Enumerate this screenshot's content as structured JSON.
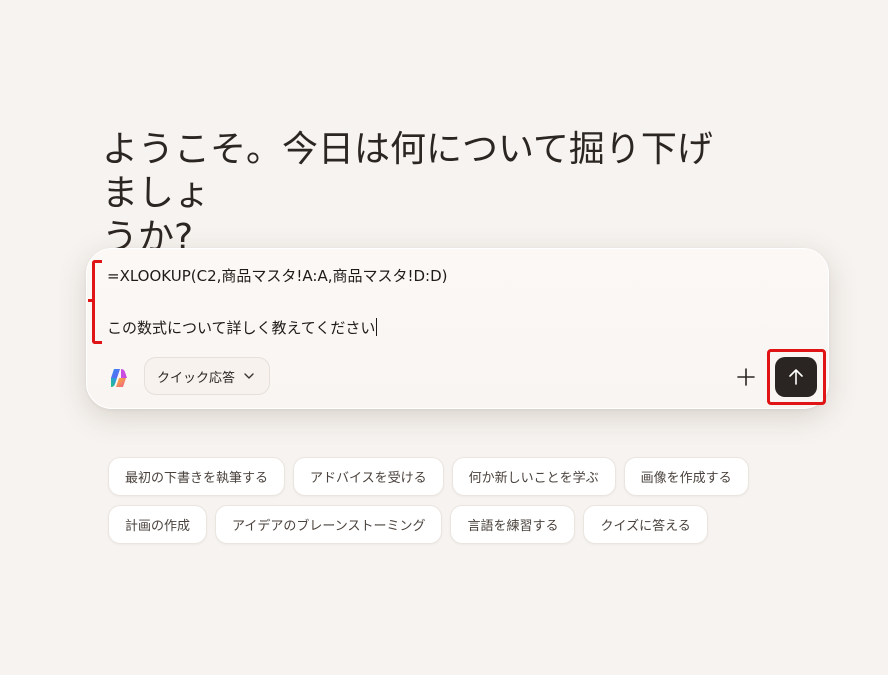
{
  "welcome": {
    "title_line1": "ようこそ。今日は何について掘り下げましょ",
    "title_line2": "うか?"
  },
  "composer": {
    "line1": "=XLOOKUP(C2,商品マスタ!A:A,商品マスタ!D:D)",
    "line2": "",
    "line3": "この数式について詳しく教えてください",
    "logo_icon": "copilot-logo-icon",
    "mode_label": "クイック応答",
    "mode_icon": "chevron-down-icon",
    "plus_icon": "plus-icon",
    "send_icon": "arrow-up-icon"
  },
  "suggestions": {
    "row1": [
      "最初の下書きを執筆する",
      "アドバイスを受ける",
      "何か新しいことを学ぶ",
      "画像を作成する"
    ],
    "row2": [
      "計画の作成",
      "アイデアのブレーンストーミング",
      "言語を練習する",
      "クイズに答える"
    ]
  },
  "colors": {
    "background": "#f6f3f0",
    "annotation": "#e01414",
    "send_button": "#2a2422"
  }
}
